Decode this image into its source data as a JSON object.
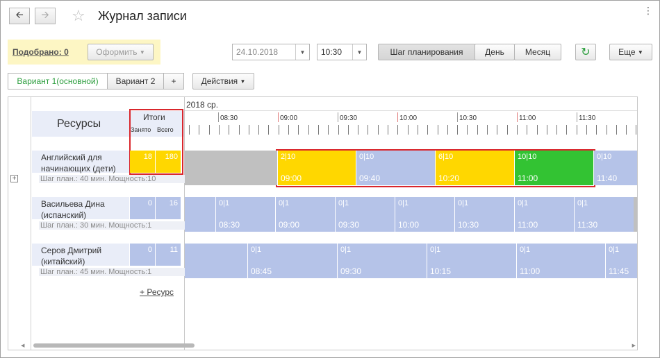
{
  "header": {
    "title": "Журнал записи",
    "back_icon": "arrow-left-icon",
    "forward_icon": "arrow-right-icon",
    "star_icon": "star-icon"
  },
  "toolbar": {
    "selected_label": "Подобрано: 0",
    "issue_label": "Оформить",
    "date_value": "24.10.2018",
    "time_value": "10:30",
    "mode_step": "Шаг планирования",
    "mode_day": "День",
    "mode_month": "Месяц",
    "more_label": "Еще",
    "refresh_icon": "refresh-icon"
  },
  "tabs": {
    "variant1": "Вариант 1(основной)",
    "variant2": "Вариант 2",
    "add": "+",
    "actions": "Действия"
  },
  "grid": {
    "date_header": "2018 ср.",
    "resources_header": "Ресурсы",
    "totals_header": "Итоги",
    "busy_header": "Занято",
    "total_header": "Всего",
    "add_resource": "+ Ресурс",
    "time_labels": [
      "08:30",
      "09:00",
      "09:30",
      "10:00",
      "10:30",
      "11:00",
      "11:30"
    ]
  },
  "resources": [
    {
      "name": "Английский для начинающих (дети)",
      "sub": "Шаг план.: 40 мин. Мощность:10",
      "busy": "18",
      "total": "180",
      "slots": [
        {
          "top": "2|10",
          "bot": "09:00",
          "color": "#ffd700"
        },
        {
          "top": "0|10",
          "bot": "09:40",
          "color": "#b5c3e8"
        },
        {
          "top": "6|10",
          "bot": "10:20",
          "color": "#ffd700"
        },
        {
          "top": "10|10",
          "bot": "11:00",
          "color": "#33c333"
        },
        {
          "top": "0|10",
          "bot": "11:40",
          "color": "#b5c3e8"
        }
      ]
    },
    {
      "name": "Васильева  Дина (испанский)",
      "sub": "Шаг план.: 30 мин. Мощность:1",
      "busy": "0",
      "total": "16",
      "slots": [
        {
          "top": "0|1",
          "bot": "08:30"
        },
        {
          "top": "0|1",
          "bot": "09:00"
        },
        {
          "top": "0|1",
          "bot": "09:30"
        },
        {
          "top": "0|1",
          "bot": "10:00"
        },
        {
          "top": "0|1",
          "bot": "10:30"
        },
        {
          "top": "0|1",
          "bot": "11:00"
        },
        {
          "top": "0|1",
          "bot": "11:30"
        }
      ]
    },
    {
      "name": "Серов Дмитрий (китайский)",
      "sub": "Шаг план.: 45 мин. Мощность:1",
      "busy": "0",
      "total": "11",
      "slots": [
        {
          "top": "0|1",
          "bot": "08:45"
        },
        {
          "top": "0|1",
          "bot": "09:30"
        },
        {
          "top": "0|1",
          "bot": "10:15"
        },
        {
          "top": "0|1",
          "bot": "11:00"
        },
        {
          "top": "0|1",
          "bot": "11:45"
        }
      ]
    }
  ],
  "colors": {
    "accent_green": "#2a9d3c",
    "slot_free": "#b5c3e8",
    "slot_partial": "#ffd700",
    "slot_full": "#33c333",
    "highlight_border": "#d9262c"
  }
}
